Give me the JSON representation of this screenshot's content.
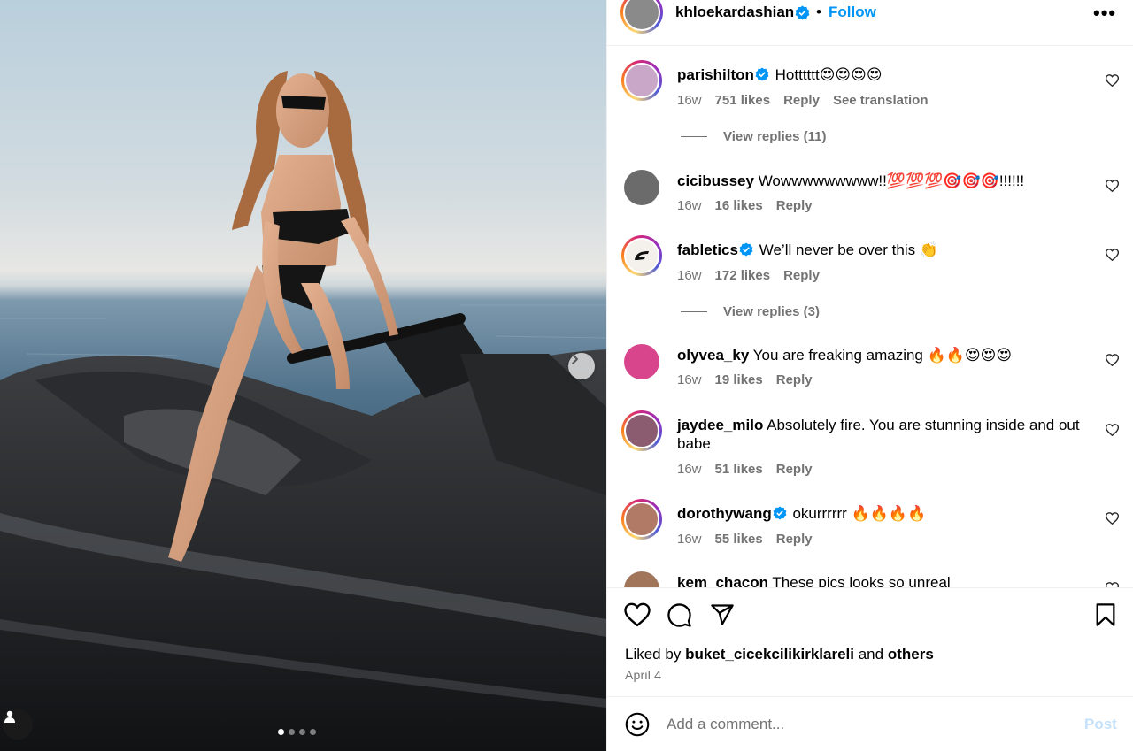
{
  "post": {
    "author": "khloekardashian",
    "author_verified": true,
    "follow_label": "Follow",
    "separator": "•",
    "more_label": "•••",
    "carousel": {
      "total_slides": 4,
      "active_slide": 1
    }
  },
  "comments": [
    {
      "username": "parishilton",
      "verified": true,
      "text": "Hotttttt😍😍😍😍",
      "age": "16w",
      "likes": "751 likes",
      "reply": "Reply",
      "translate": "See translation",
      "view_replies": "View replies (11)",
      "avatar_color": "#c9a7c8"
    },
    {
      "username": "cicibussey",
      "verified": false,
      "text": "Wowwwwwwwww!!💯💯💯🎯🎯🎯!!!!!!",
      "age": "16w",
      "likes": "16 likes",
      "reply": "Reply",
      "avatar_color": "#6b6b6b"
    },
    {
      "username": "fabletics",
      "verified": true,
      "text": "We’ll never be over this 👏",
      "age": "16w",
      "likes": "172 likes",
      "reply": "Reply",
      "view_replies": "View replies (3)",
      "avatar_color": "#f4f1ec"
    },
    {
      "username": "olyvea_ky",
      "verified": false,
      "text": "You are freaking amazing 🔥🔥😍😍😍",
      "age": "16w",
      "likes": "19 likes",
      "reply": "Reply",
      "avatar_color": "#d8458c"
    },
    {
      "username": "jaydee_milo",
      "verified": false,
      "text": "Absolutely fire. You are stunning inside and out babe",
      "age": "16w",
      "likes": "51 likes",
      "reply": "Reply",
      "avatar_color": "#8b5b6f"
    },
    {
      "username": "dorothywang",
      "verified": true,
      "text": "okurrrrrr 🔥🔥🔥🔥",
      "age": "16w",
      "likes": "55 likes",
      "reply": "Reply",
      "avatar_color": "#b07a66"
    },
    {
      "username": "kem_chacon",
      "verified": false,
      "text": "These pics looks so unreal",
      "avatar_color": "#a0755a"
    }
  ],
  "footer": {
    "liked_prefix": "Liked by",
    "liked_user": "buket_cicekcilikirklareli",
    "liked_and": "and",
    "liked_others": "others",
    "date": "April 4",
    "comment_placeholder": "Add a comment...",
    "post_label": "Post"
  },
  "icons": {
    "like": "heart-icon",
    "comment": "comment-icon",
    "share": "send-icon",
    "save": "bookmark-icon",
    "emoji": "emoji-icon",
    "verified": "verified-badge-icon",
    "next": "chevron-right-icon",
    "tag": "user-tag-icon"
  },
  "colors": {
    "accent": "#0095f6",
    "muted": "#737373",
    "post_disabled": "#c4e1fb"
  }
}
